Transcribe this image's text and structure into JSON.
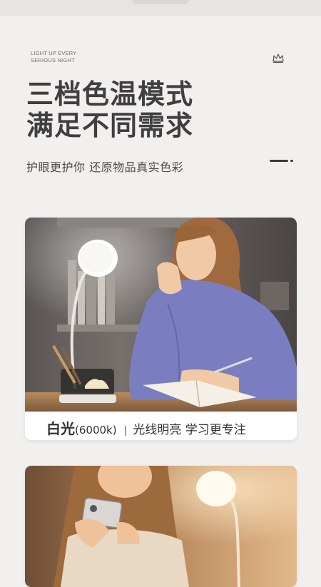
{
  "tagline": [
    "LIGHT UP EVERY",
    "SERIOUS NIGHT"
  ],
  "headline": [
    "三档色温模式",
    "满足不同需求"
  ],
  "subline": "护眼更护你 还原物品真实色彩",
  "card1": {
    "mode": "白光",
    "kelvin": "(6000k)",
    "separator": "|",
    "description": "光线明亮 学习更专注"
  },
  "icons": {
    "crown": "crown-icon"
  }
}
